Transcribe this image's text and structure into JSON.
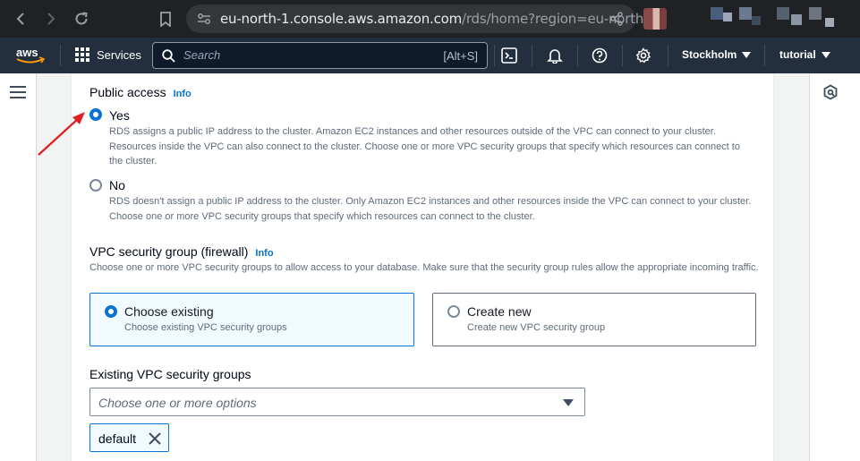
{
  "browser": {
    "url_host": "eu-north-1.console.aws.amazon.com",
    "url_path": "/rds/home?region=eu-north-..."
  },
  "aws_nav": {
    "logo": "aws",
    "services_label": "Services",
    "search_placeholder": "Search",
    "search_shortcut": "[Alt+S]",
    "region_label": "Stockholm",
    "account_label": "tutorial"
  },
  "public_access": {
    "title": "Public access",
    "info": "Info",
    "options": [
      {
        "label": "Yes",
        "selected": true,
        "description": "RDS assigns a public IP address to the cluster. Amazon EC2 instances and other resources outside of the VPC can connect to your cluster. Resources inside the VPC can also connect to the cluster. Choose one or more VPC security groups that specify which resources can connect to the cluster."
      },
      {
        "label": "No",
        "selected": false,
        "description": "RDS doesn't assign a public IP address to the cluster. Only Amazon EC2 instances and other resources inside the VPC can connect to your cluster. Choose one or more VPC security groups that specify which resources can connect to the cluster."
      }
    ]
  },
  "vpc_security_group": {
    "title": "VPC security group (firewall)",
    "info": "Info",
    "description": "Choose one or more VPC security groups to allow access to your database. Make sure that the security group rules allow the appropriate incoming traffic.",
    "tiles": [
      {
        "label": "Choose existing",
        "description": "Choose existing VPC security groups",
        "selected": true
      },
      {
        "label": "Create new",
        "description": "Create new VPC security group",
        "selected": false
      }
    ]
  },
  "existing_groups": {
    "title": "Existing VPC security groups",
    "placeholder": "Choose one or more options",
    "tokens": [
      "default"
    ]
  },
  "colors": {
    "accent": "#0972d3",
    "annotation_arrow": "#e02020",
    "aws_nav_bg": "#232f3e"
  }
}
